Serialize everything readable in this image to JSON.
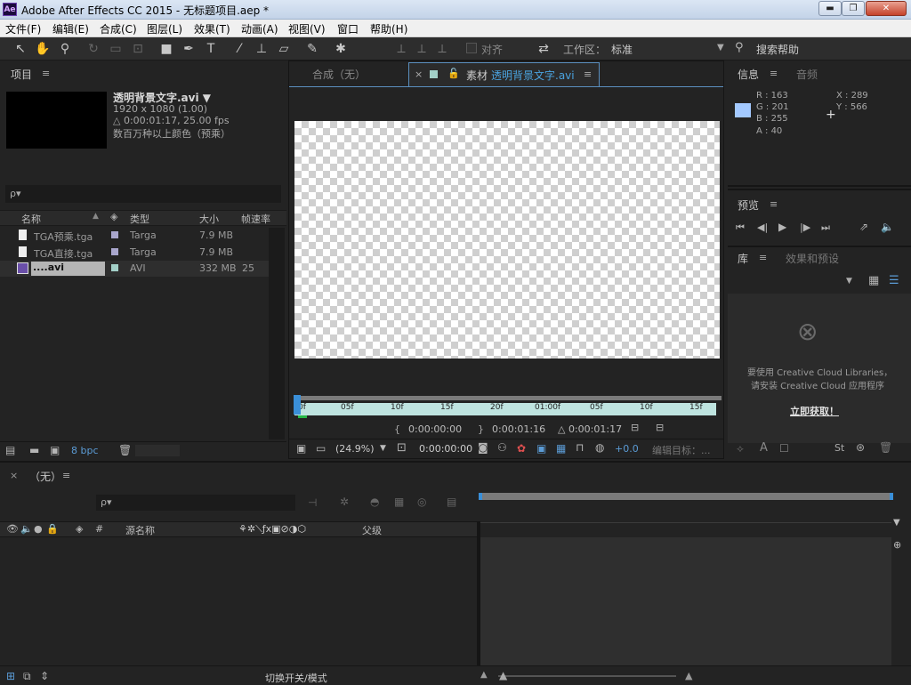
{
  "window": {
    "app_logo": "Ae",
    "title": "Adobe After Effects CC 2015 - 无标题项目.aep *",
    "min": "▬",
    "max": "❐",
    "close": "✕"
  },
  "menu": [
    "文件(F)",
    "编辑(E)",
    "合成(C)",
    "图层(L)",
    "效果(T)",
    "动画(A)",
    "视图(V)",
    "窗口",
    "帮助(H)"
  ],
  "toolbar": {
    "align_label": "对齐",
    "workspace_label": "工作区：",
    "workspace_value": "标准",
    "search_help": "搜索帮助"
  },
  "project": {
    "tab": "项目",
    "menu": "≡",
    "asset_name": "透明背景文字.avi ▼",
    "asset_size": "1920 x 1080 (1.00)",
    "asset_dur": "△ 0:00:01:17, 25.00 fps",
    "asset_color": "数百万种以上颜色（预乘）",
    "search_placeholder": "ρ▾",
    "columns": {
      "name": "名称",
      "type": "类型",
      "size": "大小",
      "fps": "帧速率"
    },
    "rows": [
      {
        "name": "TGA预乘.tga",
        "type": "Targa",
        "size": "7.9 MB",
        "fps": ""
      },
      {
        "name": "TGA直接.tga",
        "type": "Targa",
        "size": "7.9 MB",
        "fps": ""
      },
      {
        "name": "....avi",
        "type": "AVI",
        "size": "332 MB",
        "fps": "25"
      }
    ],
    "bpc": "8 bpc"
  },
  "viewer": {
    "tab_comp": "合成（无）",
    "tab_footage_prefix": "素材",
    "tab_footage_name": "透明背景文字.avi",
    "menu": "≡",
    "ruler": [
      "0f",
      "05f",
      "10f",
      "15f",
      "20f",
      "01:00f",
      "05f",
      "10f",
      "15f"
    ],
    "time_in": "0:00:00:00",
    "time_out": "0:00:01:16",
    "time_dur": "△ 0:00:01:17",
    "zoom": "(24.9%)",
    "current_time": "0:00:00:00",
    "exposure": "+0.0",
    "edit_target": "编辑目标：..."
  },
  "info": {
    "tab": "信息",
    "tab2": "音频",
    "r": "R : 163",
    "g": "G : 201",
    "b": "B : 255",
    "a": "A : 40",
    "x": "X : 289",
    "y": "Y : 566",
    "swatch": "#a3c9ff"
  },
  "preview": {
    "tab": "预览"
  },
  "library": {
    "tab": "库",
    "tab2": "效果和预设",
    "msg1": "要使用 Creative Cloud Libraries，",
    "msg2": "请安装 Creative Cloud 应用程序",
    "cta": "立即获取！"
  },
  "timeline": {
    "tab": "（无）",
    "columns": {
      "source": "源名称",
      "parent": "父级",
      "hash": "#"
    },
    "toggle_modes": "切换开关/模式"
  }
}
